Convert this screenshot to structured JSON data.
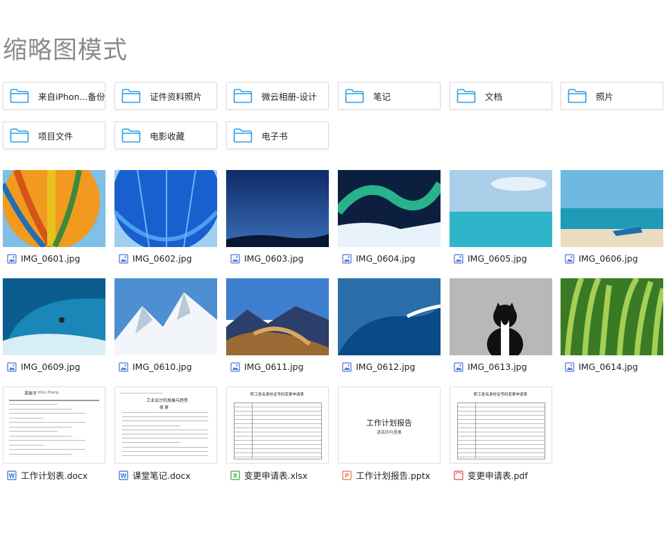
{
  "page_title": "缩略图模式",
  "folders": [
    {
      "label": "来自iPhon...备份"
    },
    {
      "label": "证件资料照片"
    },
    {
      "label": "微云相册-设计"
    },
    {
      "label": "笔记"
    },
    {
      "label": "文档"
    },
    {
      "label": "照片"
    },
    {
      "label": "项目文件"
    },
    {
      "label": "电影收藏"
    },
    {
      "label": "电子书"
    }
  ],
  "images": [
    {
      "name": "IMG_0601.jpg"
    },
    {
      "name": "IMG_0602.jpg"
    },
    {
      "name": "IMG_0603.jpg"
    },
    {
      "name": "IMG_0604.jpg"
    },
    {
      "name": "IMG_0605.jpg"
    },
    {
      "name": "IMG_0606.jpg"
    },
    {
      "name": "IMG_0609.jpg"
    },
    {
      "name": "IMG_0610.jpg"
    },
    {
      "name": "IMG_0611.jpg"
    },
    {
      "name": "IMG_0612.jpg"
    },
    {
      "name": "IMG_0613.jpg"
    },
    {
      "name": "IMG_0614.jpg"
    }
  ],
  "documents": [
    {
      "name": "工作计划表.docx",
      "type": "word-icon",
      "color": "#2b6fd6",
      "preview": {
        "heading": "郑琛子",
        "heading_en": "Kitty Zheng"
      }
    },
    {
      "name": "课堂笔记.docx",
      "type": "word-icon",
      "color": "#2b6fd6",
      "preview": {
        "heading": "工业设计的发展与趋势",
        "subheading": "摘 要"
      }
    },
    {
      "name": "变更申请表.xlsx",
      "type": "excel-icon",
      "color": "#3aa43a",
      "preview": {
        "heading": "职工姓名身份证号码变更申请表"
      }
    },
    {
      "name": "工作计划报告.pptx",
      "type": "ppt-icon",
      "color": "#e2733f",
      "preview": {
        "heading": "工作计划报告",
        "subheading": "进击的马里奥"
      }
    },
    {
      "name": "变更申请表.pdf",
      "type": "pdf-icon",
      "color": "#e04a3f",
      "preview": {
        "heading": "职工姓名身份证号码变更申请表"
      }
    }
  ],
  "colors": {
    "folder_icon": "#2b9be8",
    "image_icon": "#4a6fd6",
    "title": "#8a8a8a"
  }
}
